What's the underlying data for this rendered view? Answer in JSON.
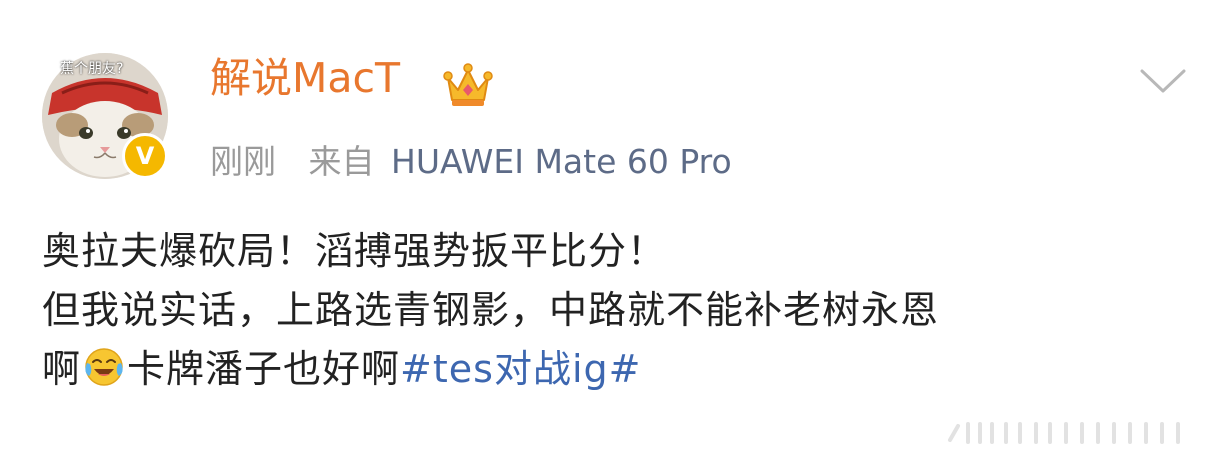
{
  "post": {
    "avatar": {
      "caption": "蕉个朋友?",
      "verified_badge": "V"
    },
    "header": {
      "username": "解说MacT",
      "crown_icon": "crown-icon",
      "time": "刚刚",
      "from_label": "来自",
      "device": "HUAWEI Mate 60 Pro"
    },
    "body": {
      "line1": "奥拉夫爆砍局！滔搏强势扳平比分！",
      "line2": "但我说实话，上路选青钢影，中路就不能补老树永恩",
      "line3_start": "啊",
      "emoji_icon": "laughing-crying-emoji",
      "line3_mid": "卡牌潘子也好啊",
      "topic": "#tes对战ig#"
    },
    "colors": {
      "username": "#e8772e",
      "device": "#5d6b87",
      "topic": "#3d67b0",
      "meta": "#9a9a9a",
      "text": "#222222"
    }
  }
}
